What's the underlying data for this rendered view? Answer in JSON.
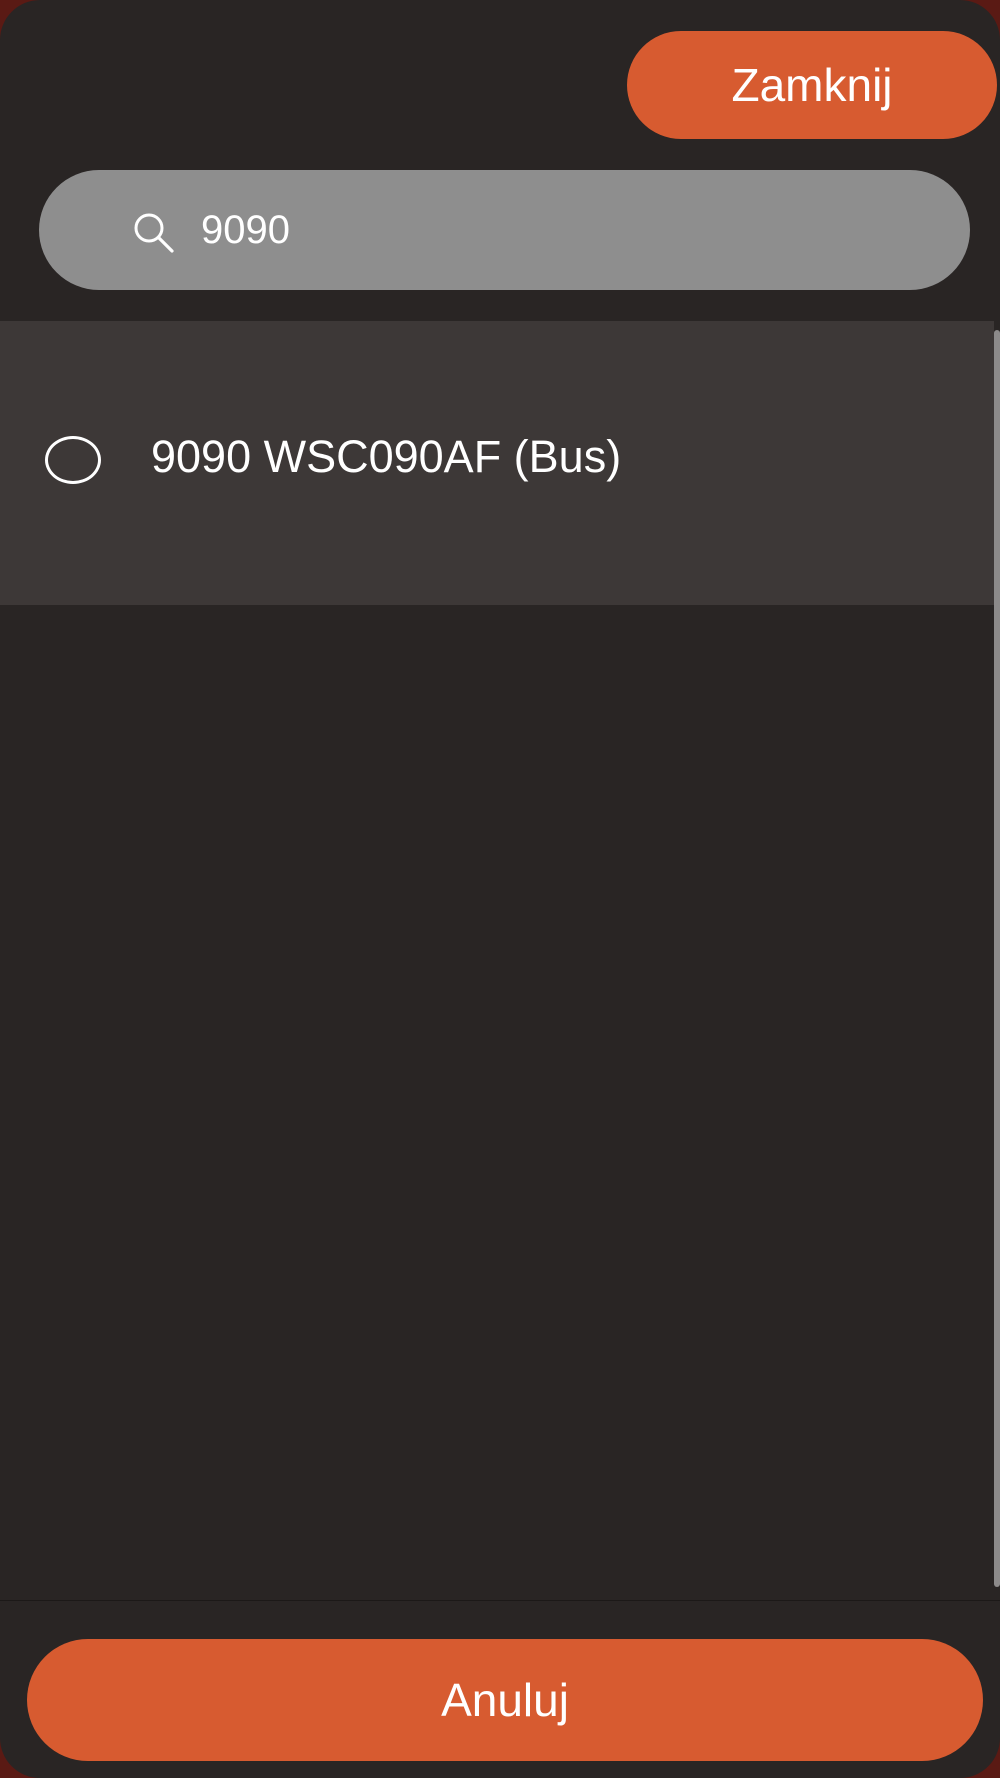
{
  "header": {
    "close_label": "Zamknij"
  },
  "search": {
    "value": "9090",
    "icon": "search-icon"
  },
  "results": {
    "items": [
      {
        "label": "9090 WSC090AF (Bus)",
        "selected": false
      }
    ]
  },
  "footer": {
    "cancel_label": "Anuluj"
  },
  "colors": {
    "accent": "#d75b30",
    "background": "#292524",
    "item_background": "#3d3837",
    "search_background": "#8e8e8e"
  }
}
